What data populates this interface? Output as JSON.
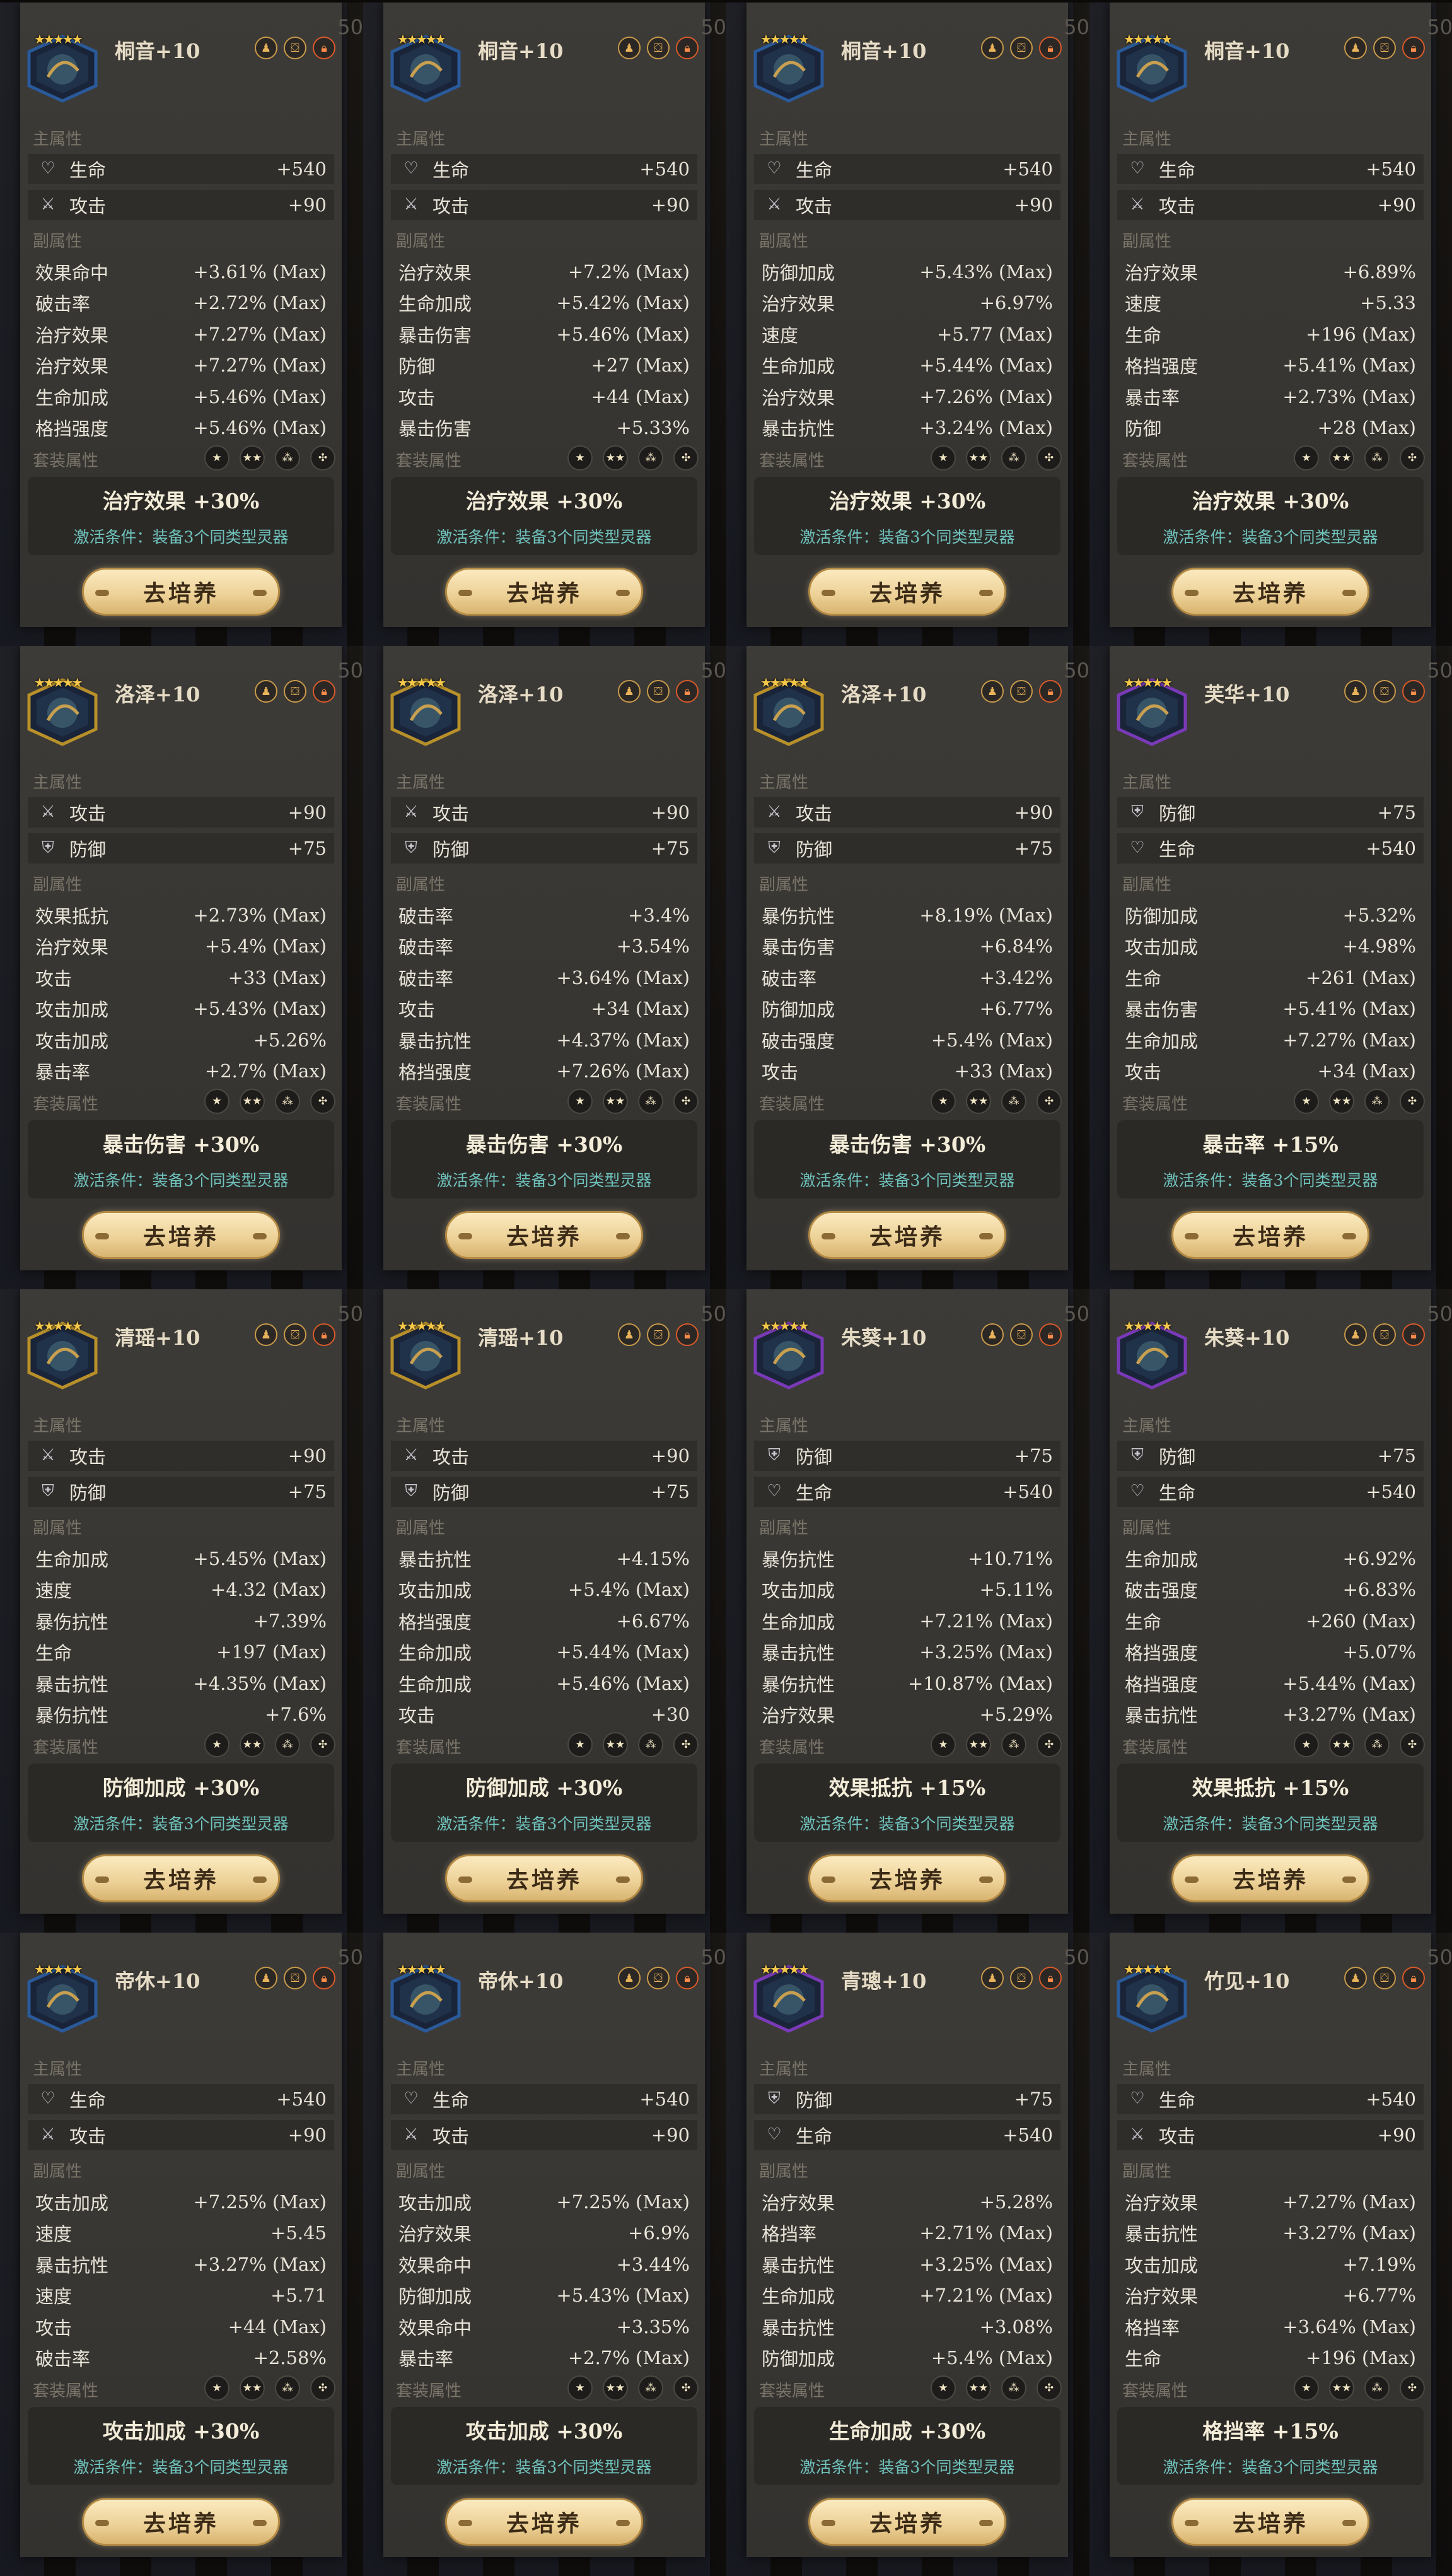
{
  "labels": {
    "main_attr": "主属性",
    "sub_attr": "副属性",
    "set_attr": "套装属性",
    "button": "去培养"
  },
  "cards": [
    {
      "name": "桐音+10",
      "stars": "★★★★★",
      "emblem_color": "#2a5a9a",
      "main": [
        {
          "icon": "heart-icon",
          "label": "生命",
          "value": "+540"
        },
        {
          "icon": "sword-icon",
          "label": "攻击",
          "value": "+90"
        }
      ],
      "sub": [
        {
          "label": "效果命中",
          "value": "+3.61% (Max)"
        },
        {
          "label": "破击率",
          "value": "+2.72% (Max)"
        },
        {
          "label": "治疗效果",
          "value": "+7.27% (Max)"
        },
        {
          "label": "治疗效果",
          "value": "+7.27% (Max)"
        },
        {
          "label": "生命加成",
          "value": "+5.46% (Max)"
        },
        {
          "label": "格挡强度",
          "value": "+5.46% (Max)"
        }
      ],
      "set_effect": "治疗效果 +30%",
      "set_cond": "激活条件：装备3个同类型灵器"
    },
    {
      "name": "桐音+10",
      "stars": "★★★★★",
      "emblem_color": "#2a5a9a",
      "main": [
        {
          "icon": "heart-icon",
          "label": "生命",
          "value": "+540"
        },
        {
          "icon": "sword-icon",
          "label": "攻击",
          "value": "+90"
        }
      ],
      "sub": [
        {
          "label": "治疗效果",
          "value": "+7.2% (Max)"
        },
        {
          "label": "生命加成",
          "value": "+5.42% (Max)"
        },
        {
          "label": "暴击伤害",
          "value": "+5.46% (Max)"
        },
        {
          "label": "防御",
          "value": "+27 (Max)"
        },
        {
          "label": "攻击",
          "value": "+44 (Max)"
        },
        {
          "label": "暴击伤害",
          "value": "+5.33%"
        }
      ],
      "set_effect": "治疗效果 +30%",
      "set_cond": "激活条件：装备3个同类型灵器"
    },
    {
      "name": "桐音+10",
      "stars": "★★★★★",
      "emblem_color": "#2a5a9a",
      "main": [
        {
          "icon": "heart-icon",
          "label": "生命",
          "value": "+540"
        },
        {
          "icon": "sword-icon",
          "label": "攻击",
          "value": "+90"
        }
      ],
      "sub": [
        {
          "label": "防御加成",
          "value": "+5.43% (Max)"
        },
        {
          "label": "治疗效果",
          "value": "+6.97%"
        },
        {
          "label": "速度",
          "value": "+5.77 (Max)"
        },
        {
          "label": "生命加成",
          "value": "+5.44% (Max)"
        },
        {
          "label": "治疗效果",
          "value": "+7.26% (Max)"
        },
        {
          "label": "暴击抗性",
          "value": "+3.24% (Max)"
        }
      ],
      "set_effect": "治疗效果 +30%",
      "set_cond": "激活条件：装备3个同类型灵器"
    },
    {
      "name": "桐音+10",
      "stars": "★★★★★",
      "emblem_color": "#2a5a9a",
      "main": [
        {
          "icon": "heart-icon",
          "label": "生命",
          "value": "+540"
        },
        {
          "icon": "sword-icon",
          "label": "攻击",
          "value": "+90"
        }
      ],
      "sub": [
        {
          "label": "治疗效果",
          "value": "+6.89%"
        },
        {
          "label": "速度",
          "value": "+5.33"
        },
        {
          "label": "生命",
          "value": "+196 (Max)"
        },
        {
          "label": "格挡强度",
          "value": "+5.41% (Max)"
        },
        {
          "label": "暴击率",
          "value": "+2.73% (Max)"
        },
        {
          "label": "防御",
          "value": "+28 (Max)"
        }
      ],
      "set_effect": "治疗效果 +30%",
      "set_cond": "激活条件：装备3个同类型灵器"
    },
    {
      "name": "洛泽+10",
      "stars": "★★★★★",
      "emblem_color": "#b8902a",
      "main": [
        {
          "icon": "sword-icon",
          "label": "攻击",
          "value": "+90"
        },
        {
          "icon": "shield-icon",
          "label": "防御",
          "value": "+75"
        }
      ],
      "sub": [
        {
          "label": "效果抵抗",
          "value": "+2.73% (Max)"
        },
        {
          "label": "治疗效果",
          "value": "+5.4% (Max)"
        },
        {
          "label": "攻击",
          "value": "+33 (Max)"
        },
        {
          "label": "攻击加成",
          "value": "+5.43% (Max)"
        },
        {
          "label": "攻击加成",
          "value": "+5.26%"
        },
        {
          "label": "暴击率",
          "value": "+2.7% (Max)"
        }
      ],
      "set_effect": "暴击伤害 +30%",
      "set_cond": "激活条件：装备3个同类型灵器"
    },
    {
      "name": "洛泽+10",
      "stars": "★★★★★",
      "emblem_color": "#b8902a",
      "main": [
        {
          "icon": "sword-icon",
          "label": "攻击",
          "value": "+90"
        },
        {
          "icon": "shield-icon",
          "label": "防御",
          "value": "+75"
        }
      ],
      "sub": [
        {
          "label": "破击率",
          "value": "+3.4%"
        },
        {
          "label": "破击率",
          "value": "+3.54%"
        },
        {
          "label": "破击率",
          "value": "+3.64% (Max)"
        },
        {
          "label": "攻击",
          "value": "+34 (Max)"
        },
        {
          "label": "暴击抗性",
          "value": "+4.37% (Max)"
        },
        {
          "label": "格挡强度",
          "value": "+7.26% (Max)"
        }
      ],
      "set_effect": "暴击伤害 +30%",
      "set_cond": "激活条件：装备3个同类型灵器"
    },
    {
      "name": "洛泽+10",
      "stars": "★★★★★",
      "emblem_color": "#b8902a",
      "main": [
        {
          "icon": "sword-icon",
          "label": "攻击",
          "value": "+90"
        },
        {
          "icon": "shield-icon",
          "label": "防御",
          "value": "+75"
        }
      ],
      "sub": [
        {
          "label": "暴伤抗性",
          "value": "+8.19% (Max)"
        },
        {
          "label": "暴击伤害",
          "value": "+6.84%"
        },
        {
          "label": "破击率",
          "value": "+3.42%"
        },
        {
          "label": "防御加成",
          "value": "+6.77%"
        },
        {
          "label": "破击强度",
          "value": "+5.4% (Max)"
        },
        {
          "label": "攻击",
          "value": "+33 (Max)"
        }
      ],
      "set_effect": "暴击伤害 +30%",
      "set_cond": "激活条件：装备3个同类型灵器"
    },
    {
      "name": "芙华+10",
      "stars": "★★★★★",
      "emblem_color": "#7a3ab8",
      "main": [
        {
          "icon": "shield-icon",
          "label": "防御",
          "value": "+75"
        },
        {
          "icon": "heart-icon",
          "label": "生命",
          "value": "+540"
        }
      ],
      "sub": [
        {
          "label": "防御加成",
          "value": "+5.32%"
        },
        {
          "label": "攻击加成",
          "value": "+4.98%"
        },
        {
          "label": "生命",
          "value": "+261 (Max)"
        },
        {
          "label": "暴击伤害",
          "value": "+5.41% (Max)"
        },
        {
          "label": "生命加成",
          "value": "+7.27% (Max)"
        },
        {
          "label": "攻击",
          "value": "+34 (Max)"
        }
      ],
      "set_effect": "暴击率 +15%",
      "set_cond": "激活条件：装备3个同类型灵器"
    },
    {
      "name": "清瑶+10",
      "stars": "★★★★★",
      "emblem_color": "#b8902a",
      "main": [
        {
          "icon": "sword-icon",
          "label": "攻击",
          "value": "+90"
        },
        {
          "icon": "shield-icon",
          "label": "防御",
          "value": "+75"
        }
      ],
      "sub": [
        {
          "label": "生命加成",
          "value": "+5.45% (Max)"
        },
        {
          "label": "速度",
          "value": "+4.32 (Max)"
        },
        {
          "label": "暴伤抗性",
          "value": "+7.39%"
        },
        {
          "label": "生命",
          "value": "+197 (Max)"
        },
        {
          "label": "暴击抗性",
          "value": "+4.35% (Max)"
        },
        {
          "label": "暴伤抗性",
          "value": "+7.6%"
        }
      ],
      "set_effect": "防御加成 +30%",
      "set_cond": "激活条件：装备3个同类型灵器"
    },
    {
      "name": "清瑶+10",
      "stars": "★★★★★",
      "emblem_color": "#b8902a",
      "main": [
        {
          "icon": "sword-icon",
          "label": "攻击",
          "value": "+90"
        },
        {
          "icon": "shield-icon",
          "label": "防御",
          "value": "+75"
        }
      ],
      "sub": [
        {
          "label": "暴击抗性",
          "value": "+4.15%"
        },
        {
          "label": "攻击加成",
          "value": "+5.4% (Max)"
        },
        {
          "label": "格挡强度",
          "value": "+6.67%"
        },
        {
          "label": "生命加成",
          "value": "+5.44% (Max)"
        },
        {
          "label": "生命加成",
          "value": "+5.46% (Max)"
        },
        {
          "label": "攻击",
          "value": "+30"
        }
      ],
      "set_effect": "防御加成 +30%",
      "set_cond": "激活条件：装备3个同类型灵器"
    },
    {
      "name": "朱葵+10",
      "stars": "★★★★★",
      "emblem_color": "#7a3ab8",
      "main": [
        {
          "icon": "shield-icon",
          "label": "防御",
          "value": "+75"
        },
        {
          "icon": "heart-icon",
          "label": "生命",
          "value": "+540"
        }
      ],
      "sub": [
        {
          "label": "暴伤抗性",
          "value": "+10.71%"
        },
        {
          "label": "攻击加成",
          "value": "+5.11%"
        },
        {
          "label": "生命加成",
          "value": "+7.21% (Max)"
        },
        {
          "label": "暴击抗性",
          "value": "+3.25% (Max)"
        },
        {
          "label": "暴伤抗性",
          "value": "+10.87% (Max)"
        },
        {
          "label": "治疗效果",
          "value": "+5.29%"
        }
      ],
      "set_effect": "效果抵抗 +15%",
      "set_cond": "激活条件：装备3个同类型灵器"
    },
    {
      "name": "朱葵+10",
      "stars": "★★★★★",
      "emblem_color": "#7a3ab8",
      "main": [
        {
          "icon": "shield-icon",
          "label": "防御",
          "value": "+75"
        },
        {
          "icon": "heart-icon",
          "label": "生命",
          "value": "+540"
        }
      ],
      "sub": [
        {
          "label": "生命加成",
          "value": "+6.92%"
        },
        {
          "label": "破击强度",
          "value": "+6.83%"
        },
        {
          "label": "生命",
          "value": "+260 (Max)"
        },
        {
          "label": "格挡强度",
          "value": "+5.07%"
        },
        {
          "label": "格挡强度",
          "value": "+5.44% (Max)"
        },
        {
          "label": "暴击抗性",
          "value": "+3.27% (Max)"
        }
      ],
      "set_effect": "效果抵抗 +15%",
      "set_cond": "激活条件：装备3个同类型灵器"
    },
    {
      "name": "帝休+10",
      "stars": "★★★★★",
      "emblem_color": "#2a5a9a",
      "main": [
        {
          "icon": "heart-icon",
          "label": "生命",
          "value": "+540"
        },
        {
          "icon": "sword-icon",
          "label": "攻击",
          "value": "+90"
        }
      ],
      "sub": [
        {
          "label": "攻击加成",
          "value": "+7.25% (Max)"
        },
        {
          "label": "速度",
          "value": "+5.45"
        },
        {
          "label": "暴击抗性",
          "value": "+3.27% (Max)"
        },
        {
          "label": "速度",
          "value": "+5.71"
        },
        {
          "label": "攻击",
          "value": "+44 (Max)"
        },
        {
          "label": "破击率",
          "value": "+2.58%"
        }
      ],
      "set_effect": "攻击加成 +30%",
      "set_cond": "激活条件：装备3个同类型灵器"
    },
    {
      "name": "帝休+10",
      "stars": "★★★★★",
      "emblem_color": "#2a5a9a",
      "main": [
        {
          "icon": "heart-icon",
          "label": "生命",
          "value": "+540"
        },
        {
          "icon": "sword-icon",
          "label": "攻击",
          "value": "+90"
        }
      ],
      "sub": [
        {
          "label": "攻击加成",
          "value": "+7.25% (Max)"
        },
        {
          "label": "治疗效果",
          "value": "+6.9%"
        },
        {
          "label": "效果命中",
          "value": "+3.44%"
        },
        {
          "label": "防御加成",
          "value": "+5.43% (Max)"
        },
        {
          "label": "效果命中",
          "value": "+3.35%"
        },
        {
          "label": "暴击率",
          "value": "+2.7% (Max)"
        }
      ],
      "set_effect": "攻击加成 +30%",
      "set_cond": "激活条件：装备3个同类型灵器"
    },
    {
      "name": "青璁+10",
      "stars": "★★★★★",
      "emblem_color": "#7a3ab8",
      "main": [
        {
          "icon": "shield-icon",
          "label": "防御",
          "value": "+75"
        },
        {
          "icon": "heart-icon",
          "label": "生命",
          "value": "+540"
        }
      ],
      "sub": [
        {
          "label": "治疗效果",
          "value": "+5.28%"
        },
        {
          "label": "格挡率",
          "value": "+2.71% (Max)"
        },
        {
          "label": "暴击抗性",
          "value": "+3.25% (Max)"
        },
        {
          "label": "生命加成",
          "value": "+7.21% (Max)"
        },
        {
          "label": "暴击抗性",
          "value": "+3.08%"
        },
        {
          "label": "防御加成",
          "value": "+5.4% (Max)"
        }
      ],
      "set_effect": "生命加成 +30%",
      "set_cond": "激活条件：装备3个同类型灵器"
    },
    {
      "name": "竹见+10",
      "stars": "★★★★★",
      "emblem_color": "#2a5a9a",
      "main": [
        {
          "icon": "heart-icon",
          "label": "生命",
          "value": "+540"
        },
        {
          "icon": "sword-icon",
          "label": "攻击",
          "value": "+90"
        }
      ],
      "sub": [
        {
          "label": "治疗效果",
          "value": "+7.27% (Max)"
        },
        {
          "label": "暴击抗性",
          "value": "+3.27% (Max)"
        },
        {
          "label": "攻击加成",
          "value": "+7.19%"
        },
        {
          "label": "治疗效果",
          "value": "+6.77%"
        },
        {
          "label": "格挡率",
          "value": "+3.64% (Max)"
        },
        {
          "label": "生命",
          "value": "+196 (Max)"
        }
      ],
      "set_effect": "格挡率 +15%",
      "set_cond": "激活条件：装备3个同类型灵器"
    }
  ]
}
